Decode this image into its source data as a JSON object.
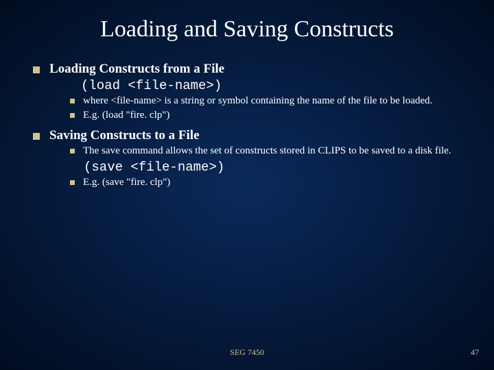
{
  "title": "Loading and Saving Constructs",
  "sections": [
    {
      "heading": "Loading Constructs from a File",
      "code": "(load <file-name>)",
      "subs": [
        "where <file-name> is a string or symbol containing the name of the file to be loaded.",
        "E.g. (load \"fire. clp\")"
      ]
    },
    {
      "heading": "Saving Constructs to a File",
      "subs_top": [
        "The save command allows the set of constructs stored in CLIPS to be saved to a disk file."
      ],
      "code": "(save <file-name>)",
      "subs_bottom": [
        "E.g. (save \"fire. clp\")"
      ]
    }
  ],
  "footer": {
    "center": "SEG 7450",
    "page": "47"
  }
}
